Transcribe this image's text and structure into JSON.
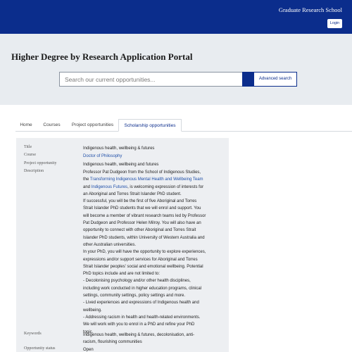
{
  "header": {
    "site_name": "Graduate Research School",
    "login_label": "Login"
  },
  "hero": {
    "title": "Higher Degree by Research Application Portal",
    "search_placeholder": "Search our current opportunities...",
    "advanced_search_label": "Advanced search"
  },
  "tabs": [
    {
      "label": "Home"
    },
    {
      "label": "Courses"
    },
    {
      "label": "Project opportunities"
    },
    {
      "label": "Scholarship opportunities"
    }
  ],
  "details": {
    "title_label": "Title",
    "title_value": "Indigenous health, wellbeing & futures",
    "course_label": "Course",
    "course_value": "Doctor of Philosophy",
    "project_label": "Project opportunity",
    "project_value": "Indigenous health, wellbeing and futures",
    "description_label": "Description",
    "description": {
      "l1": "Professor Pat Dudgeon from the School of Indigenous Studies,",
      "l2_pre": "the ",
      "l2_link": "Transforming Indigenous Mental Health and Wellbeing Team",
      "l3_pre": "and ",
      "l3_link": "Indigenous Futures",
      "l3_post": ", is welcoming expression of interests for",
      "l4": "an Aboriginal and Torres Strait Islander PhD student.",
      "l5": "If successful, you will be the first of five Aboriginal and Torres",
      "l6": "Strait Islander PhD students that we will enrol and support. You",
      "l7": "will become a member of vibrant research teams led by Professor",
      "l8": "Pat Dudgeon and Professor Helen Milroy. You will also have an",
      "l9": "opportunity to connect with other Aboriginal and Torres Strait",
      "l10": "Islander PhD students, within University of Western Australia and",
      "l11": "other Australian universities.",
      "l12": "In your PhD, you will have the opportunity to explore experiences,",
      "l13": "expressions and/or support services for Aboriginal and Torres",
      "l14": "Strait Islander peoples' social and emotional wellbeing.  Potential",
      "l15": "PhD topics include and are not limited to:",
      "l16": "- Decolonising psychology and/or other health disciplines,",
      "l17": "including work conducted in higher education programs, clinical",
      "l18": "settings, community settings, policy settings and more.",
      "l19": "- Lived experiences and expressions of Indigenous health and",
      "l20": "wellbeing.",
      "l21": "- Addressing racism in health and health-related environments.",
      "l22": "We will work with you to enrol in a PhD and refine your PhD",
      "l23": "topic."
    },
    "keywords_label": "Keywords",
    "keywords_l1": "Indigenous health, wellbeing & futures, decolonisation, anti-",
    "keywords_l2": "racism, flourishing communities",
    "status_label": "Opportunity status",
    "status_value": "Open"
  }
}
